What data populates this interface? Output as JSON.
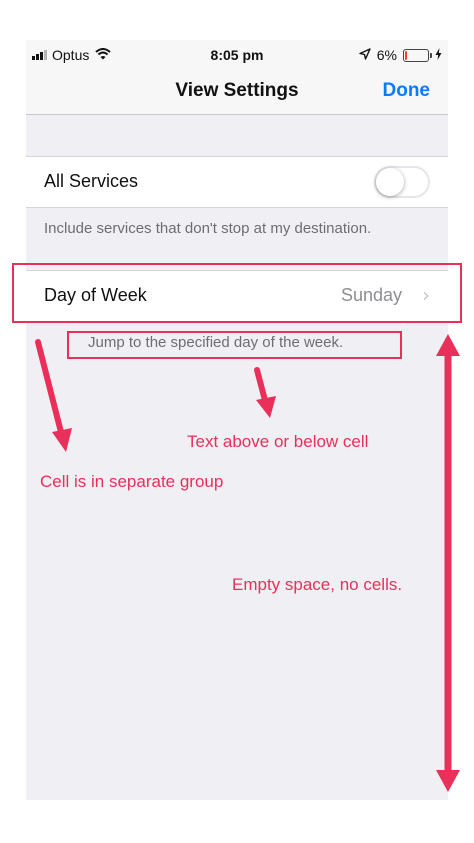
{
  "status_bar": {
    "carrier": "Optus",
    "time": "8:05 pm",
    "battery": "6%"
  },
  "nav": {
    "title": "View Settings",
    "done_label": "Done"
  },
  "group1": {
    "cell_label": "All Services",
    "toggle_on": false,
    "footer": "Include services that don't stop at my destination."
  },
  "group2": {
    "cell_label": "Day of Week",
    "cell_value": "Sunday",
    "footer": "Jump to the specified day of the week."
  },
  "annotations": {
    "text_above_below": "Text above or below cell",
    "separate_group": "Cell is in separate group",
    "empty_space": "Empty space, no cells."
  },
  "colors": {
    "accent": "#0a7aff",
    "annotation": "#e8305a",
    "background": "#efeff4"
  },
  "icons": [
    "signal-bars-icon",
    "wifi-icon",
    "location-arrow-icon",
    "battery-icon",
    "charging-bolt-icon",
    "chevron-right-icon"
  ]
}
